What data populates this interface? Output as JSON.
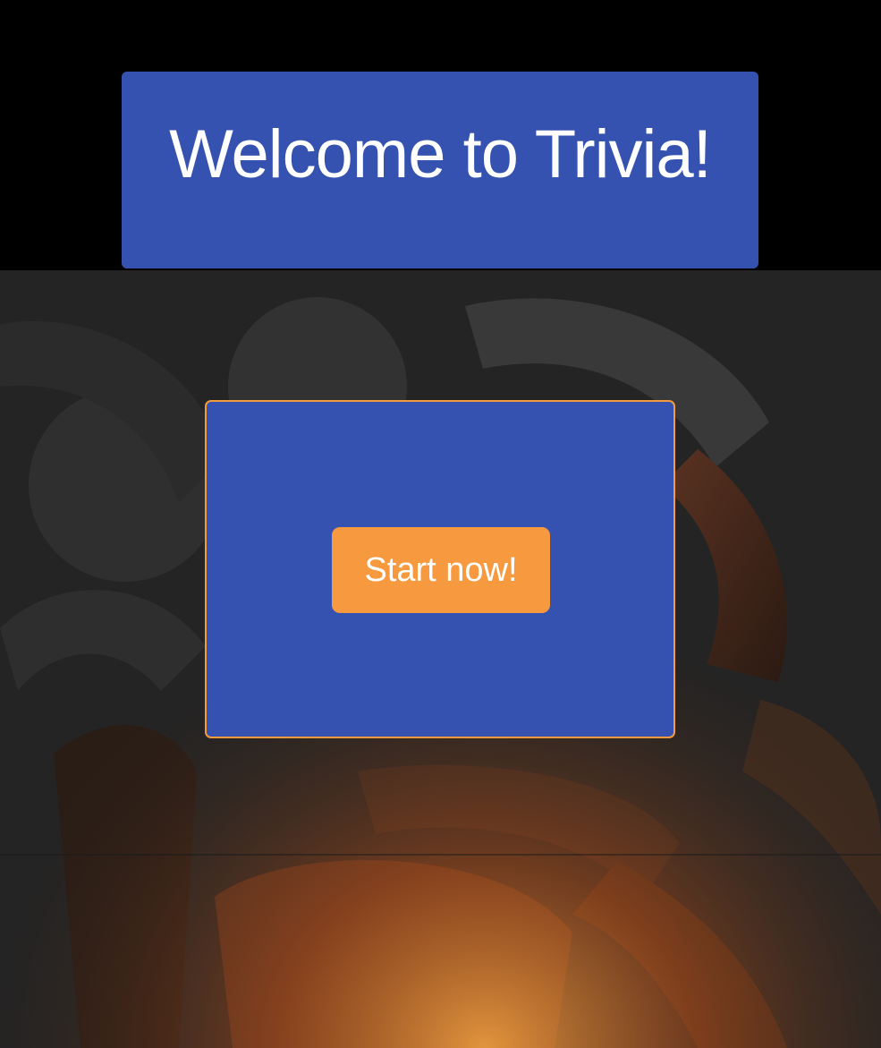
{
  "header": {
    "title": "Welcome to Trivia!"
  },
  "start_card": {
    "button_label": "Start now!"
  },
  "colors": {
    "card_blue": "#3552b0",
    "accent_orange": "#f6993f",
    "top_band": "#000000"
  },
  "background": {
    "icon": "question-mark-pattern"
  }
}
